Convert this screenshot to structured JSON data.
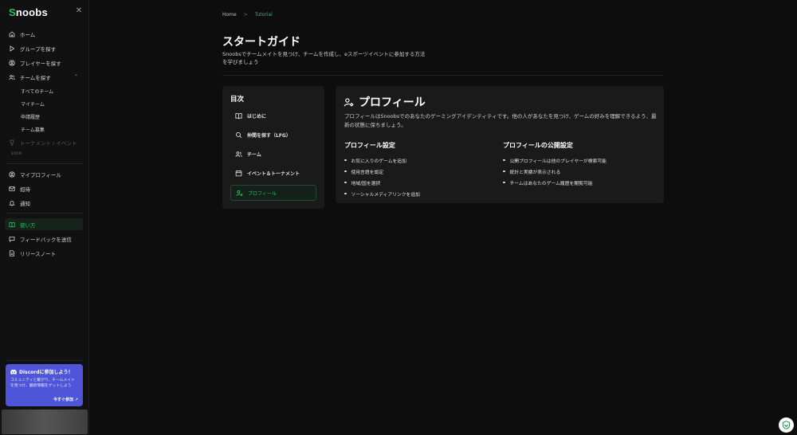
{
  "app": {
    "logo_initial": "S",
    "logo_rest": "noobs"
  },
  "sidebar": {
    "close_icon": "close-icon",
    "items": [
      {
        "label": "ホーム",
        "icon": "home-icon"
      },
      {
        "label": "グループを探す",
        "icon": "play-icon"
      },
      {
        "label": "プレイヤーを探す",
        "icon": "user-circle-icon"
      },
      {
        "label": "チームを探す",
        "icon": "users-icon",
        "expanded": true
      }
    ],
    "team_sub": [
      "すべてのチーム",
      "マイチーム",
      "申請履歴",
      "チーム募集"
    ],
    "disabled_item": {
      "label": "トーナメント / イベント",
      "icon": "trophy-icon",
      "badge": "SOON"
    },
    "account_items": [
      {
        "label": "マイプロフィール",
        "icon": "user-circle-icon"
      },
      {
        "label": "招待",
        "icon": "mail-icon"
      },
      {
        "label": "通知",
        "icon": "bell-icon"
      }
    ],
    "help_items": [
      {
        "label": "使い方",
        "icon": "book-icon",
        "active": true
      },
      {
        "label": "フィードバックを送信",
        "icon": "message-icon"
      },
      {
        "label": "リリースノート",
        "icon": "file-icon"
      }
    ],
    "discord": {
      "title": "Discordに参加しよう！",
      "body": "コミュニティと繋がり、チームメイトを見つけ、最新情報をゲットしよう",
      "cta": "今すぐ参加"
    }
  },
  "breadcrumb": {
    "home": "Home",
    "separator": ">",
    "current": "Tutorial"
  },
  "page": {
    "title": "スタートガイド",
    "subtitle": "Snoobsでチームメイトを見つけ、チームを作成し、eスポーツイベントに参加する方法を学びましょう"
  },
  "toc": {
    "title": "目次",
    "items": [
      {
        "label": "はじめに",
        "icon": "book-icon"
      },
      {
        "label": "仲間を探す（LFG）",
        "icon": "search-icon"
      },
      {
        "label": "チーム",
        "icon": "users-icon"
      },
      {
        "label": "イベント＆トーナメント",
        "icon": "calendar-icon"
      },
      {
        "label": "プロフィール",
        "icon": "user-cog-icon",
        "active": true
      }
    ]
  },
  "section": {
    "title": "プロフィール",
    "icon": "user-cog-icon",
    "description": "プロフィールはSnoobsでのあなたのゲーミングアイデンティティです。他の人があなたを見つけ、ゲームの好みを理解できるよう、最新の状態に保ちましょう。",
    "col1": {
      "title": "プロフィール設定",
      "items": [
        "お気に入りのゲームを追加",
        "使用言語を設定",
        "地域/国を選択",
        "ソーシャルメディアリンクを追加"
      ]
    },
    "col2": {
      "title": "プロフィールの公開設定",
      "items": [
        "公開プロフィールは他のプレイヤーが検索可能",
        "統計と実績が表示される",
        "チームはあなたのゲーム履歴を閲覧可能"
      ]
    }
  },
  "colors": {
    "accent": "#22c55e",
    "discord": "#4f55d8",
    "background": "#0d0d0d",
    "card": "#1a1a1a"
  }
}
